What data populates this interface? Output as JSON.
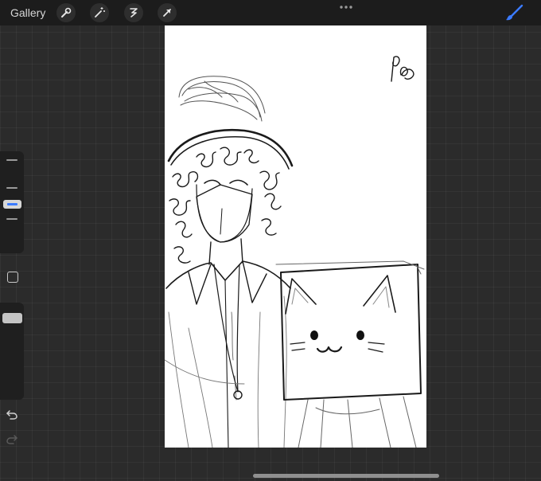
{
  "app": {
    "gallery_label": "Gallery"
  },
  "toolbar": {
    "left_tools": [
      "wrench-icon",
      "magic-wand-icon",
      "selection-icon",
      "transform-arrow-icon"
    ],
    "more_icon": "ellipsis-icon",
    "active_tool": "brush-icon",
    "accent_color": "#3b7bff"
  },
  "sidebar": {
    "brush_size_level": 0.45,
    "opacity_level": 0.85,
    "modify_icon": "square-modify-icon",
    "undo_icon": "undo-icon",
    "redo_icon": "redo-icon"
  },
  "canvas": {
    "background_color": "#ffffff",
    "content": "sketch-drawing"
  }
}
